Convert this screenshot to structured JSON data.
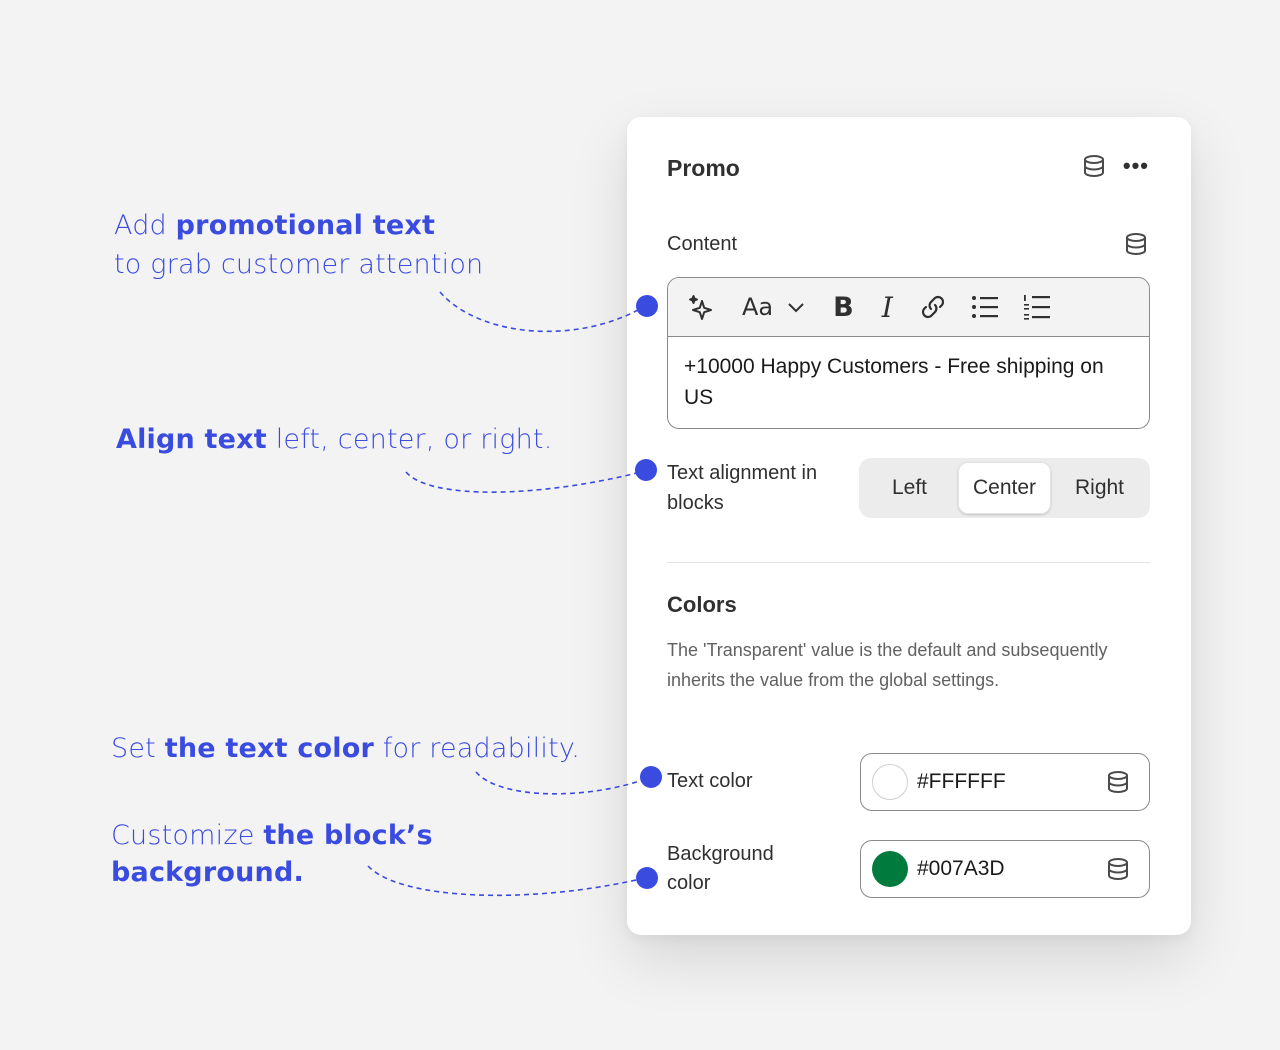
{
  "callouts": {
    "promo": {
      "pre": "Add ",
      "bold": "promotional text",
      "line2": "to grab customer attention"
    },
    "align": {
      "bold": "Align text",
      "post": " left, center, or right."
    },
    "text_color": {
      "pre": "Set ",
      "bold": "the text color",
      "post": " for readability."
    },
    "background": {
      "pre": "Customize ",
      "bold": "the block’s",
      "line2": "background."
    }
  },
  "panel": {
    "title": "Promo",
    "header_icons": [
      "database-icon",
      "more-horizontal-icon"
    ],
    "more_glyph": "•••",
    "content": {
      "label": "Content",
      "toolbar": {
        "font_button": "Aa",
        "bold_button": "B",
        "italic_button": "I",
        "icons": [
          "sparkle-icon",
          "chevron-down-icon",
          "link-icon",
          "bullet-list-icon",
          "numbered-list-icon"
        ]
      },
      "text": "+10000 Happy Customers - Free shipping on US"
    },
    "alignment": {
      "label": "Text alignment in blocks",
      "options": [
        "Left",
        "Center",
        "Right"
      ],
      "selected": "Center"
    },
    "colors": {
      "title": "Colors",
      "description": "The 'Transparent' value is the default and subsequently inherits the value from the global settings.",
      "text_color": {
        "label": "Text color",
        "value": "#FFFFFF"
      },
      "background_color": {
        "label": "Background color",
        "value": "#007A3D"
      }
    }
  },
  "theme": {
    "accent": "#3a4be0",
    "panel_bg": "#ffffff",
    "page_bg": "#f3f3f3"
  }
}
